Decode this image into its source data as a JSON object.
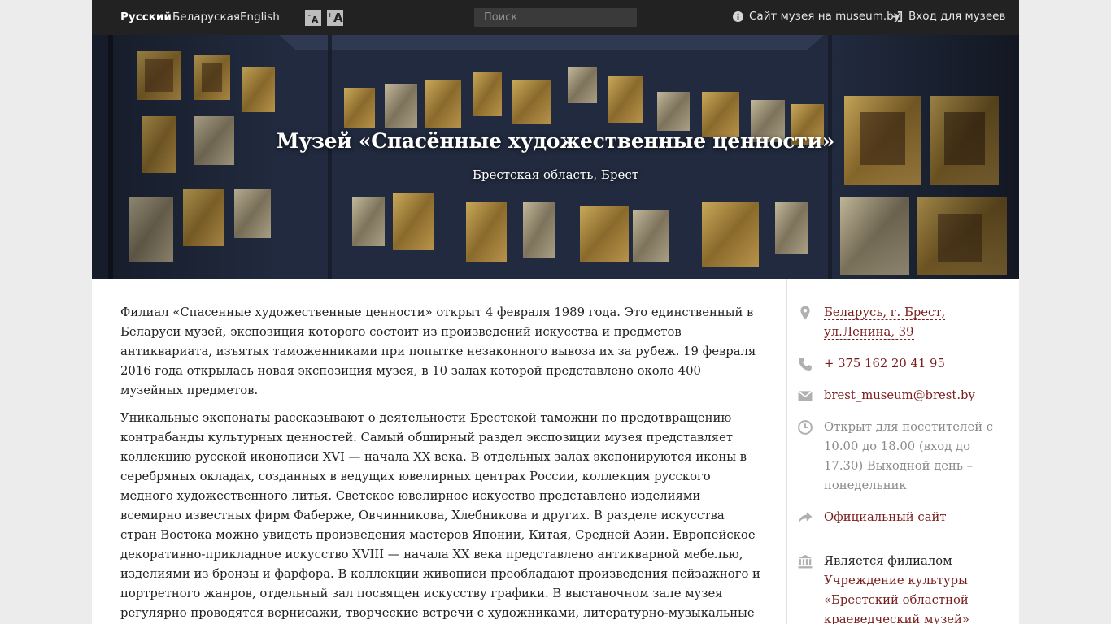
{
  "topbar": {
    "languages": [
      {
        "label": "Русский",
        "active": true
      },
      {
        "label": "Беларуская",
        "active": false
      },
      {
        "label": "English",
        "active": false
      }
    ],
    "font_small_label": "A",
    "font_big_label": "A",
    "search_placeholder": "Поиск",
    "museum_site_label": "Сайт музея на museum.by",
    "login_label": "Вход для музеев"
  },
  "hero": {
    "title": "Музей «Спасённые художественные ценности»",
    "subtitle": "Брестская область, Брест"
  },
  "content": {
    "paragraphs": [
      "Филиал «Спасенные художественные ценности» открыт 4 февраля 1989 года. Это единственный в Беларуси музей, экспозиция которого состоит из произведений искусства и предметов антиквариата, изъятых таможенниками при попытке незаконного вывоза их за рубеж. 19 февраля 2016 года открылась новая экспозиция музея, в 10 залах которой представлено около 400 музейных предметов.",
      "Уникальные экспонаты рассказывают о деятельности Брестской таможни по предотвращению контрабанды культурных ценностей. Самый обширный раздел экспозиции музея представляет коллекцию русской иконописи XVI — начала XX века. В отдельных залах экспонируются иконы в серебряных окладах, созданных в ведущих ювелирных центрах России, коллекция русского медного художественного литья. Светское ювелирное искусство представлено изделиями всемирно известных фирм Фаберже, Овчинникова, Хлебникова и других. В разделе искусства стран Востока можно увидеть произведения мастеров Японии, Китая, Средней Азии. Европейское декоративно-прикладное искусство XVIII — начала XX века представлено антикварной мебелью, изделиями из бронзы и фарфора. В коллекции живописи преобладают произведения пейзажного и портретного жанров, отдельный зал посвящен искусству графики. В выставочном зале музея регулярно проводятся вернисажи, творческие встречи с художниками, литературно-музыкальные вечера, концерты камерной музыки, мастер-классы и музейно-педагогические занятия."
    ]
  },
  "sidebar": {
    "address": "Беларусь, г. Брест, ул.Ленина, 39",
    "phone": "+ 375 162 20 41 95",
    "email": "brest_museum@brest.by",
    "hours": "Открыт для посетителей с 10.00 до 18.00 (вход до 17.30) Выходной день – понедельник",
    "official_site": "Официальный сайт",
    "branch_heading": "Является филиалом",
    "branch_link": "Учреждение культуры «Брестский областной краеведческий музей»"
  },
  "colors": {
    "topbar_bg": "#222222",
    "link": "#7a1c1c",
    "muted": "#8a8a8a",
    "icon": "#b0b0b0"
  }
}
